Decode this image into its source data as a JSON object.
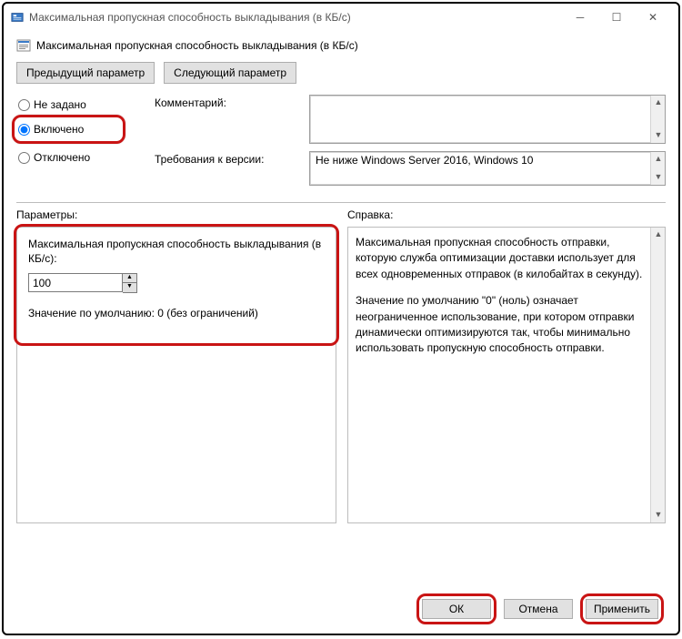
{
  "window": {
    "title": "Максимальная пропускная способность выкладывания (в КБ/с)"
  },
  "header": {
    "title": "Максимальная пропускная способность выкладывания (в КБ/с)"
  },
  "nav": {
    "prev": "Предыдущий параметр",
    "next": "Следующий параметр"
  },
  "radios": {
    "not_configured": "Не задано",
    "enabled": "Включено",
    "disabled": "Отключено"
  },
  "fields": {
    "comment_label": "Комментарий:",
    "requirements_label": "Требования к версии:",
    "requirements_value": "Не ниже Windows Server 2016, Windows 10"
  },
  "params": {
    "section_label": "Параметры:",
    "text": "Максимальная пропускная способность выкладывания (в КБ/с):",
    "value": "100",
    "default_text": "Значение по умолчанию: 0 (без ограничений)"
  },
  "help": {
    "section_label": "Справка:",
    "p1": "Максимальная пропускная способность отправки, которую служба оптимизации доставки использует для всех одновременных отправок (в килобайтах в секунду).",
    "p2": "Значение по умолчанию \"0\" (ноль) означает неограниченное использование, при котором отправки динамически оптимизируются так, чтобы минимально использовать пропускную способность отправки."
  },
  "footer": {
    "ok": "ОК",
    "cancel": "Отмена",
    "apply": "Применить"
  }
}
